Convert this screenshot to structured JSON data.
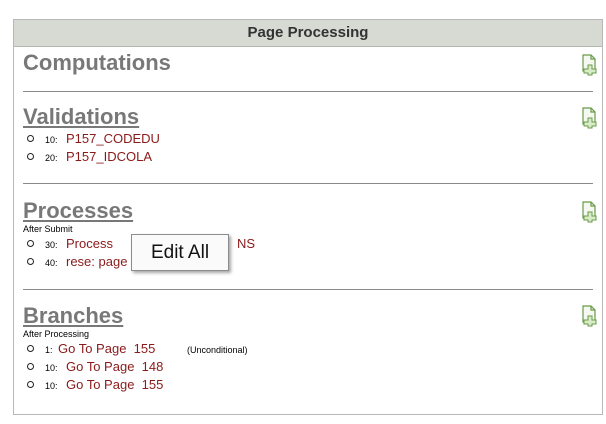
{
  "panel": {
    "title": "Page Processing"
  },
  "computations": {
    "title": "Computations"
  },
  "validations": {
    "title": "Validations",
    "items": [
      {
        "seq": "10:",
        "name": "P157_CODEDU"
      },
      {
        "seq": "20:",
        "name": "P157_IDCOLA"
      }
    ]
  },
  "processes": {
    "title": "Processes",
    "point": "After Submit",
    "items": [
      {
        "seq": "30:",
        "name": "Process",
        "name_tail": "NS"
      },
      {
        "seq": "40:",
        "name": "rese: page"
      }
    ]
  },
  "branches": {
    "title": "Branches",
    "point": "After Processing",
    "items": [
      {
        "seq": "1:",
        "name": "Go To Page  155",
        "note": "(Unconditional)"
      },
      {
        "seq": "10:",
        "name": "Go To Page  148"
      },
      {
        "seq": "10:",
        "name": "Go To Page  155"
      }
    ]
  },
  "tooltip": {
    "text": "Edit All"
  },
  "icons": {
    "add": "page-add-icon"
  },
  "colors": {
    "header_bg": "#d6dad3",
    "link": "#8b1a1a",
    "title": "#787878",
    "icon_green": "#6a9a4a"
  }
}
